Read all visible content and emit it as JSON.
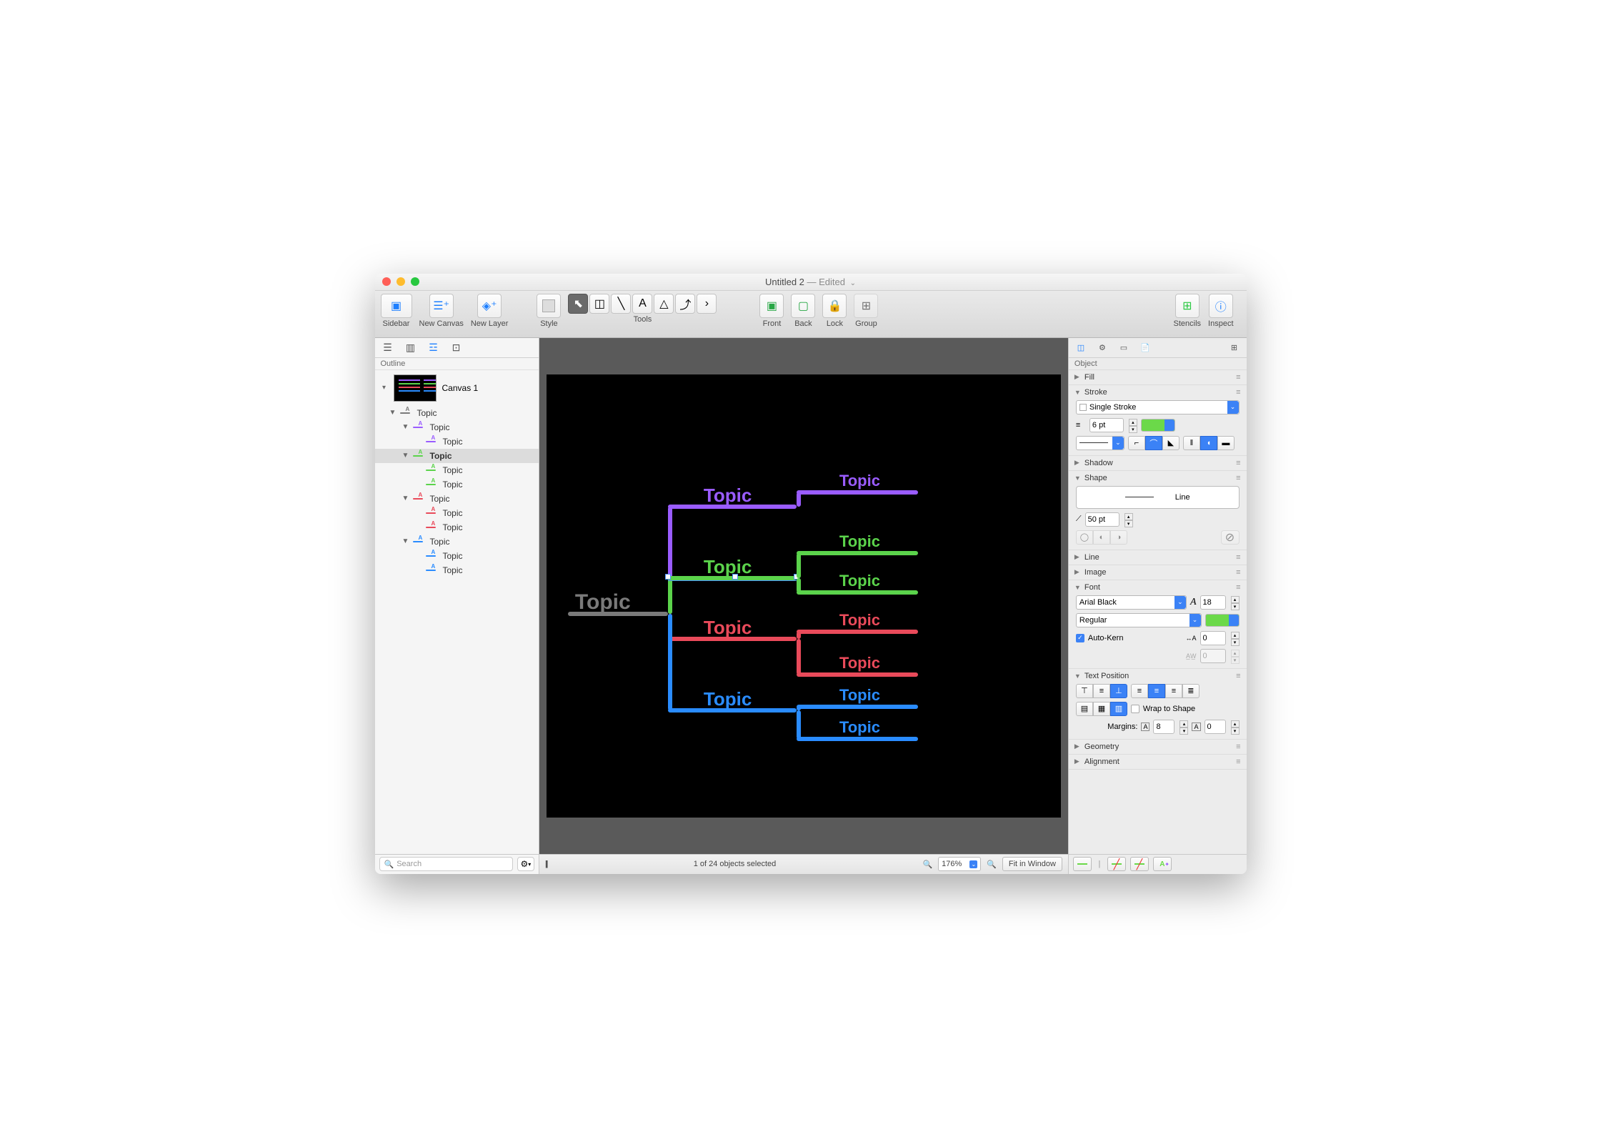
{
  "window": {
    "title": "Untitled 2",
    "edited": "— Edited"
  },
  "toolbar": {
    "sidebar": "Sidebar",
    "new_canvas": "New Canvas",
    "new_layer": "New Layer",
    "style": "Style",
    "tools": "Tools",
    "front": "Front",
    "back": "Back",
    "lock": "Lock",
    "group": "Group",
    "stencils": "Stencils",
    "inspect": "Inspect"
  },
  "left": {
    "panel_title": "Outline",
    "canvas_name": "Canvas 1",
    "search_placeholder": "Search",
    "tree": [
      {
        "label": "Topic",
        "indent": 0,
        "color": "#7a7a7a",
        "expanded": true,
        "selected": false
      },
      {
        "label": "Topic",
        "indent": 1,
        "color": "#9a5cff",
        "expanded": true,
        "selected": false
      },
      {
        "label": "Topic",
        "indent": 2,
        "color": "#9a5cff",
        "expanded": false,
        "selected": false,
        "leaf": true
      },
      {
        "label": "Topic",
        "indent": 1,
        "color": "#5bd34b",
        "expanded": true,
        "selected": true
      },
      {
        "label": "Topic",
        "indent": 2,
        "color": "#5bd34b",
        "expanded": false,
        "selected": false,
        "leaf": true
      },
      {
        "label": "Topic",
        "indent": 2,
        "color": "#5bd34b",
        "expanded": false,
        "selected": false,
        "leaf": true
      },
      {
        "label": "Topic",
        "indent": 1,
        "color": "#e94a5a",
        "expanded": true,
        "selected": false
      },
      {
        "label": "Topic",
        "indent": 2,
        "color": "#e94a5a",
        "expanded": false,
        "selected": false,
        "leaf": true
      },
      {
        "label": "Topic",
        "indent": 2,
        "color": "#e94a5a",
        "expanded": false,
        "selected": false,
        "leaf": true
      },
      {
        "label": "Topic",
        "indent": 1,
        "color": "#2a8cff",
        "expanded": true,
        "selected": false
      },
      {
        "label": "Topic",
        "indent": 2,
        "color": "#2a8cff",
        "expanded": false,
        "selected": false,
        "leaf": true
      },
      {
        "label": "Topic",
        "indent": 2,
        "color": "#2a8cff",
        "expanded": false,
        "selected": false,
        "leaf": true
      }
    ]
  },
  "canvas": {
    "root": "Topic",
    "branches": [
      {
        "color": "#9a5cff",
        "label": "Topic",
        "children": [
          "Topic"
        ]
      },
      {
        "color": "#5bd34b",
        "label": "Topic",
        "children": [
          "Topic",
          "Topic"
        ],
        "selected": true
      },
      {
        "color": "#e94a5a",
        "label": "Topic",
        "children": [
          "Topic",
          "Topic"
        ]
      },
      {
        "color": "#2a8cff",
        "label": "Topic",
        "children": [
          "Topic",
          "Topic"
        ]
      }
    ]
  },
  "status": {
    "selection": "1 of 24 objects selected",
    "zoom": "176%",
    "fit": "Fit in Window"
  },
  "inspector": {
    "panel_title": "Object",
    "fill": "Fill",
    "stroke": {
      "title": "Stroke",
      "type": "Single Stroke",
      "width": "6 pt",
      "color": "#6bd949"
    },
    "shadow": "Shadow",
    "shape": {
      "title": "Shape",
      "name": "Line",
      "corner": "50 pt"
    },
    "line": "Line",
    "image": "Image",
    "font": {
      "title": "Font",
      "family": "Arial Black",
      "size": "18",
      "style": "Regular",
      "autokern_label": "Auto-Kern",
      "autokern": true,
      "kern": "0",
      "tracking": "0"
    },
    "text_position": {
      "title": "Text Position",
      "wrap_label": "Wrap to Shape",
      "wrap": false,
      "margins_label": "Margins:",
      "margin_h": "8",
      "margin_v": "0"
    },
    "geometry": "Geometry",
    "alignment": "Alignment"
  }
}
